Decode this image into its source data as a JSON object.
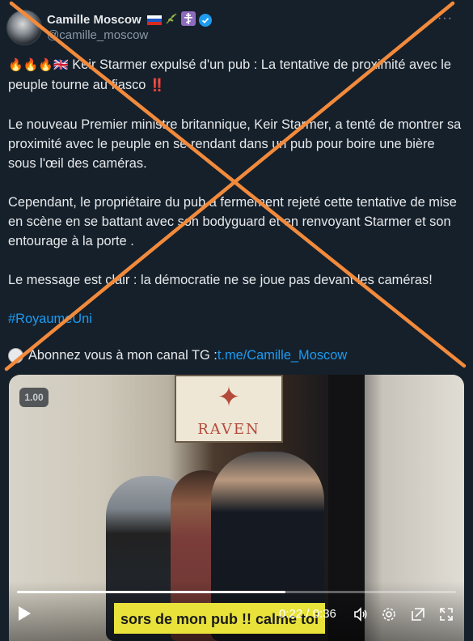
{
  "author": {
    "display_name": "Camille Moscow",
    "handle": "@camille_moscow",
    "badges": [
      "russia-flag-icon",
      "olive-branch-icon",
      "orthodox-cross-icon",
      "verified-badge-icon"
    ],
    "verified_color": "#1d9bf0"
  },
  "more_label": "···",
  "tweet": {
    "headline_emojis": "🔥🔥🔥🇬🇧",
    "headline": " Keir Starmer expulsé d'un pub : La tentative de proximité avec le peuple tourne au fiasco ",
    "headline_end_emoji": "‼️",
    "paragraph1": "Le nouveau Premier ministre britannique, Keir Starmer, a tenté de montrer sa proximité avec le peuple en se rendant dans un pub pour boire une bière sous l'œil des caméras.",
    "paragraph2": "Cependant, le propriétaire du pub a fermement rejeté cette tentative de mise en scène en se battant avec son bodyguard et en renvoyant Starmer et son entourage à la porte .",
    "paragraph3": "Le message est clair : la démocratie ne se joue pas devant les caméras!",
    "hashtag": "#RoyaumeUni",
    "cta_text": "Abonnez vous à mon canal TG : ",
    "cta_link": "t.me/Camille_Moscow"
  },
  "video": {
    "speed_label": "1.00",
    "sign_text": "RAVEN",
    "caption": "sors de mon pub !!  calme toi",
    "time": "0:22 / 0:36",
    "progress": 0.611,
    "controls": [
      "play-icon",
      "volume-icon",
      "settings-icon",
      "popout-icon",
      "fullscreen-icon"
    ]
  },
  "overlay": {
    "cross_color": "#f28a3c"
  },
  "colors": {
    "background": "#15202b",
    "text": "#e7e9ea",
    "secondary": "#8b98a5",
    "link": "#1d9bf0"
  }
}
